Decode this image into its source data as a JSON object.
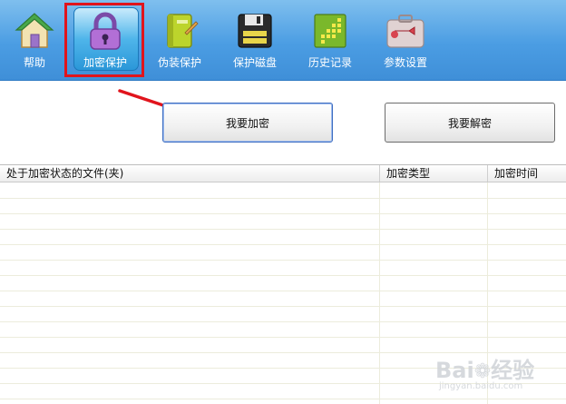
{
  "toolbar": {
    "items": [
      {
        "label": "帮助",
        "icon": "house-icon"
      },
      {
        "label": "加密保护",
        "icon": "padlock-icon",
        "active": true
      },
      {
        "label": "伪装保护",
        "icon": "notebook-icon"
      },
      {
        "label": "保护磁盘",
        "icon": "floppy-disk-icon"
      },
      {
        "label": "历史记录",
        "icon": "history-chart-icon"
      },
      {
        "label": "参数设置",
        "icon": "wrench-icon"
      }
    ]
  },
  "actions": {
    "encrypt_label": "我要加密",
    "decrypt_label": "我要解密"
  },
  "table": {
    "columns": [
      "处于加密状态的文件(夹)",
      "加密类型",
      "加密时间"
    ],
    "rows": []
  },
  "watermark": {
    "brand": "Bai",
    "brand_suffix": "经验",
    "url": "jingyan.baidu.com"
  },
  "colors": {
    "toolbar_top": "#7fbfee",
    "toolbar_bottom": "#3f8fd8",
    "highlight": "#e1141c",
    "arrow": "#e1141c"
  }
}
